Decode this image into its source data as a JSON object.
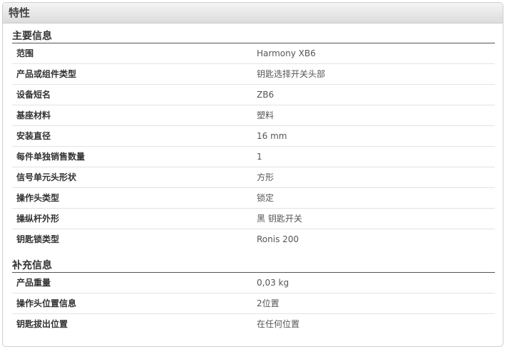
{
  "panel": {
    "title": "特性"
  },
  "sections": [
    {
      "title": "主要信息",
      "rows": [
        {
          "label": "范围",
          "value": "Harmony XB6"
        },
        {
          "label": "产品或组件类型",
          "value": "钥匙选择开关头部"
        },
        {
          "label": "设备短名",
          "value": "ZB6"
        },
        {
          "label": "基座材料",
          "value": "塑料"
        },
        {
          "label": "安装直径",
          "value": "16 mm"
        },
        {
          "label": "每件单独销售数量",
          "value": "1"
        },
        {
          "label": "信号单元头形状",
          "value": "方形"
        },
        {
          "label": "操作头类型",
          "value": "锁定"
        },
        {
          "label": "操纵杆外形",
          "value": "黑 钥匙开关"
        },
        {
          "label": "钥匙锁类型",
          "value": "Ronis 200"
        }
      ]
    },
    {
      "title": "补充信息",
      "rows": [
        {
          "label": "产品重量",
          "value": "0,03 kg"
        },
        {
          "label": "操作头位置信息",
          "value": "2位置"
        },
        {
          "label": "钥匙拔出位置",
          "value": "在任何位置"
        }
      ]
    }
  ]
}
